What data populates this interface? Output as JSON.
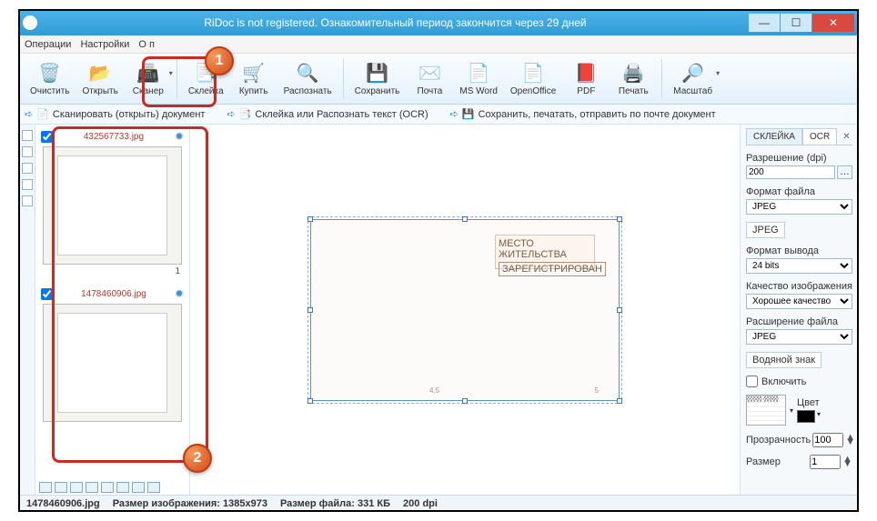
{
  "title": "RiDoc is not registered. Ознакомительный период закончится через 29 дней",
  "menu": {
    "ops": "Операции",
    "settings": "Настройки",
    "about": "О п"
  },
  "ribbon": {
    "clear": "Очистить",
    "open": "Открыть",
    "scanner": "Сканер",
    "glue": "Склейка",
    "buy": "Купить",
    "ocr": "Распознать",
    "save": "Сохранить",
    "mail": "Почта",
    "word": "MS Word",
    "oo": "OpenOffice",
    "pdf": "PDF",
    "print": "Печать",
    "zoom": "Масштаб"
  },
  "hints": {
    "h1": "Сканировать (открыть) документ",
    "h2": "Склейка или Распознать текст (OCR)",
    "h3": "Сохранить, печатать, отправить по почте документ"
  },
  "thumbs": [
    {
      "file": "432567733.jpg",
      "num": "1"
    },
    {
      "file": "1478460906.jpg",
      "num": ""
    }
  ],
  "rpanel": {
    "tab_glue": "СКЛЕЙКА",
    "tab_ocr": "OCR",
    "res_lbl": "Разрешение (dpi)",
    "res_val": "200",
    "fmt_lbl": "Формат файла",
    "fmt_val": "JPEG",
    "jpeg_tab": "JPEG",
    "out_lbl": "Формат вывода",
    "out_val": "24 bits",
    "qual_lbl": "Качество изображения",
    "qual_val": "Хорошее качество",
    "ext_lbl": "Расширение файла",
    "ext_val": "JPEG",
    "wm_tab": "Водяной знак",
    "wm_enable": "Включить",
    "wm_color": "Цвет",
    "wm_op_lbl": "Прозрачность",
    "wm_op_val": "100",
    "wm_sz_lbl": "Размер",
    "wm_sz_val": "1"
  },
  "preview": {
    "stamp_title": "МЕСТО ЖИТЕЛЬСТВА",
    "stamp_reg": "ЗАРЕГИСТРИРОВАН",
    "pl": "4,5",
    "pr": "5"
  },
  "status": {
    "file": "1478460906.jpg",
    "sz_lbl": "Размер изображения:",
    "sz_val": "1385x973",
    "fs_lbl": "Размер файла:",
    "fs_val": "331 КБ",
    "dpi": "200 dpi"
  },
  "callouts": {
    "c1": "1",
    "c2": "2"
  }
}
